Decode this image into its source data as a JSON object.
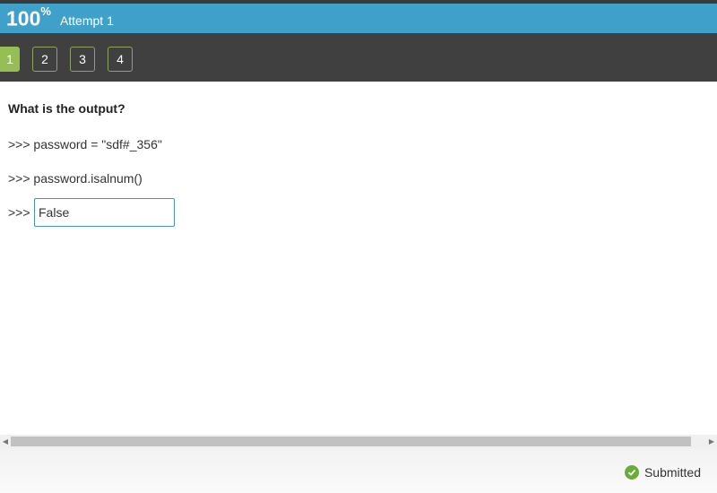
{
  "header": {
    "score_value": "100",
    "score_unit": "%",
    "attempt_label": "Attempt 1"
  },
  "question_nav": {
    "items": [
      {
        "label": "1",
        "active": true
      },
      {
        "label": "2",
        "active": false
      },
      {
        "label": "3",
        "active": false
      },
      {
        "label": "4",
        "active": false
      }
    ]
  },
  "question": {
    "title": "What is the output?",
    "lines": [
      ">>> password = \"sdf#_356\"",
      ">>> password.isalnum()"
    ],
    "answer_prompt": ">>>",
    "answer_value": "False"
  },
  "scrollbar": {
    "left_arrow": "◀",
    "right_arrow": "▶"
  },
  "footer": {
    "status_icon": "check-circle-icon",
    "status_color": "#6aab3a",
    "status_text": "Submitted"
  },
  "colors": {
    "header_bg": "#3fa1c9",
    "nav_bg": "#404040",
    "active_question": "#95bf55"
  }
}
